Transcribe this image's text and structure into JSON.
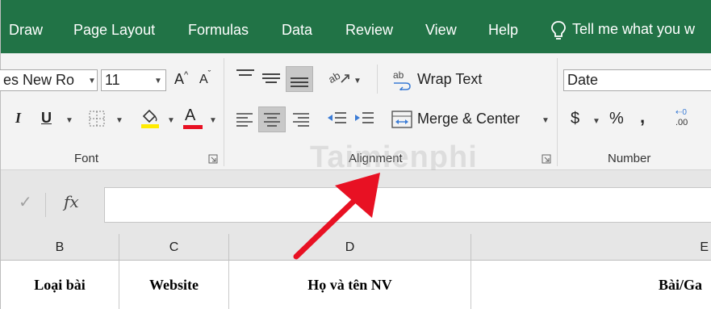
{
  "ribbon_tabs": [
    "Draw",
    "Page Layout",
    "Formulas",
    "Data",
    "Review",
    "View",
    "Help"
  ],
  "tell_me": "Tell me what you w",
  "font_group": {
    "font_name": "es New Ro",
    "font_size": "11",
    "grow_label": "A",
    "shrink_label": "A",
    "italic": "I",
    "underline": "U",
    "font_color_letter": "A",
    "label": "Font"
  },
  "alignment_group": {
    "wrap_text": "Wrap Text",
    "wrap_icon": "ab",
    "merge_center": "Merge & Center",
    "label": "Alignment"
  },
  "number_group": {
    "format_value": "Date",
    "currency": "$",
    "percent": "%",
    "comma": ",",
    "increase_decimal": ".00",
    "label": "Number"
  },
  "formula_bar": {
    "fx": "fx",
    "check": "✓",
    "content": ""
  },
  "columns": [
    {
      "header": "B",
      "cell": "Loại bài"
    },
    {
      "header": "C",
      "cell": "Website"
    },
    {
      "header": "D",
      "cell": "Họ và tên NV"
    },
    {
      "header": "E",
      "cell": "Bài/Ga"
    }
  ],
  "watermark": "Taimienphi",
  "colors": {
    "ribbon_green": "#217346",
    "font_color_underline": "#e81123",
    "highlight_underline": "#ffeb00",
    "arrow": "#e81123"
  }
}
